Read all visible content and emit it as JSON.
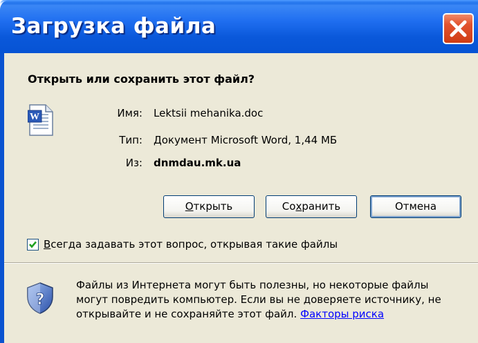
{
  "window": {
    "title": "Загрузка файла",
    "close_glyph": "X"
  },
  "prompt": {
    "question": "Открыть или сохранить этот файл?"
  },
  "file": {
    "name_label": "Имя:",
    "name_value": "Lektsii mehanika.doc",
    "type_label": "Тип:",
    "type_value": "Документ Microsoft Word, 1,44 МБ",
    "from_label": "Из:",
    "from_value": "dnmdau.mk.ua",
    "icon": "word-document-icon"
  },
  "buttons": {
    "open_mnemonic": "О",
    "open_rest": "ткрыть",
    "save_prefix": "Со",
    "save_mnemonic": "х",
    "save_rest": "ранить",
    "cancel": "Отмена"
  },
  "checkbox": {
    "checked": true,
    "label_mnemonic": "В",
    "label_rest": "сегда задавать этот вопрос, открывая такие файлы"
  },
  "warning": {
    "icon": "shield-question-icon",
    "line1": "Файлы из Интернета могут быть полезны, но некоторые файлы",
    "line2": "могут повредить компьютер. Если вы не доверяете источнику, не",
    "line3": "открывайте и не сохраняйте этот файл.",
    "link": "Факторы риска"
  },
  "colors": {
    "titlebar": "#0a5fe0",
    "face": "#ece9d8",
    "close": "#e2532f",
    "link": "#0000ff"
  }
}
